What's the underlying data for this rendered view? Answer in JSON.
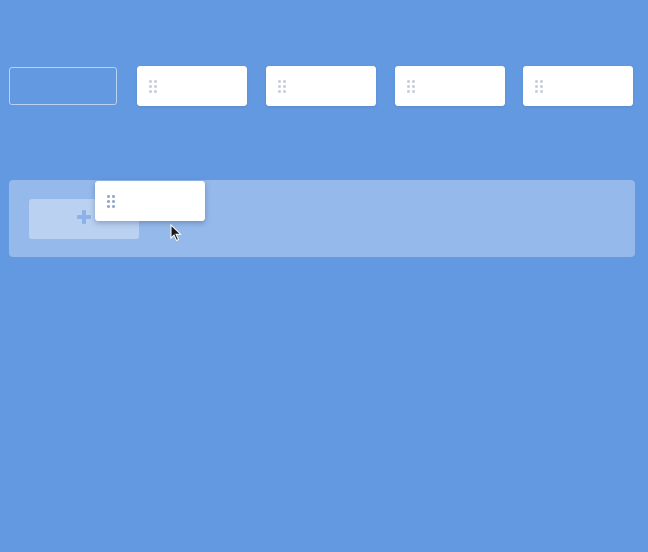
{
  "colors": {
    "background": "#6399e0",
    "card": "#ffffff",
    "grip_dots": "#c8cfd8"
  },
  "top_row": {
    "empty_slot": true,
    "cards": [
      {
        "icon": "drag-handle-icon"
      },
      {
        "icon": "drag-handle-icon"
      },
      {
        "icon": "drag-handle-icon"
      },
      {
        "icon": "drag-handle-icon"
      }
    ]
  },
  "drop_zone": {
    "add_button_icon": "plus-icon",
    "dragging_card_icon": "drag-handle-icon"
  },
  "cursor": {
    "icon": "arrow-cursor-icon"
  }
}
